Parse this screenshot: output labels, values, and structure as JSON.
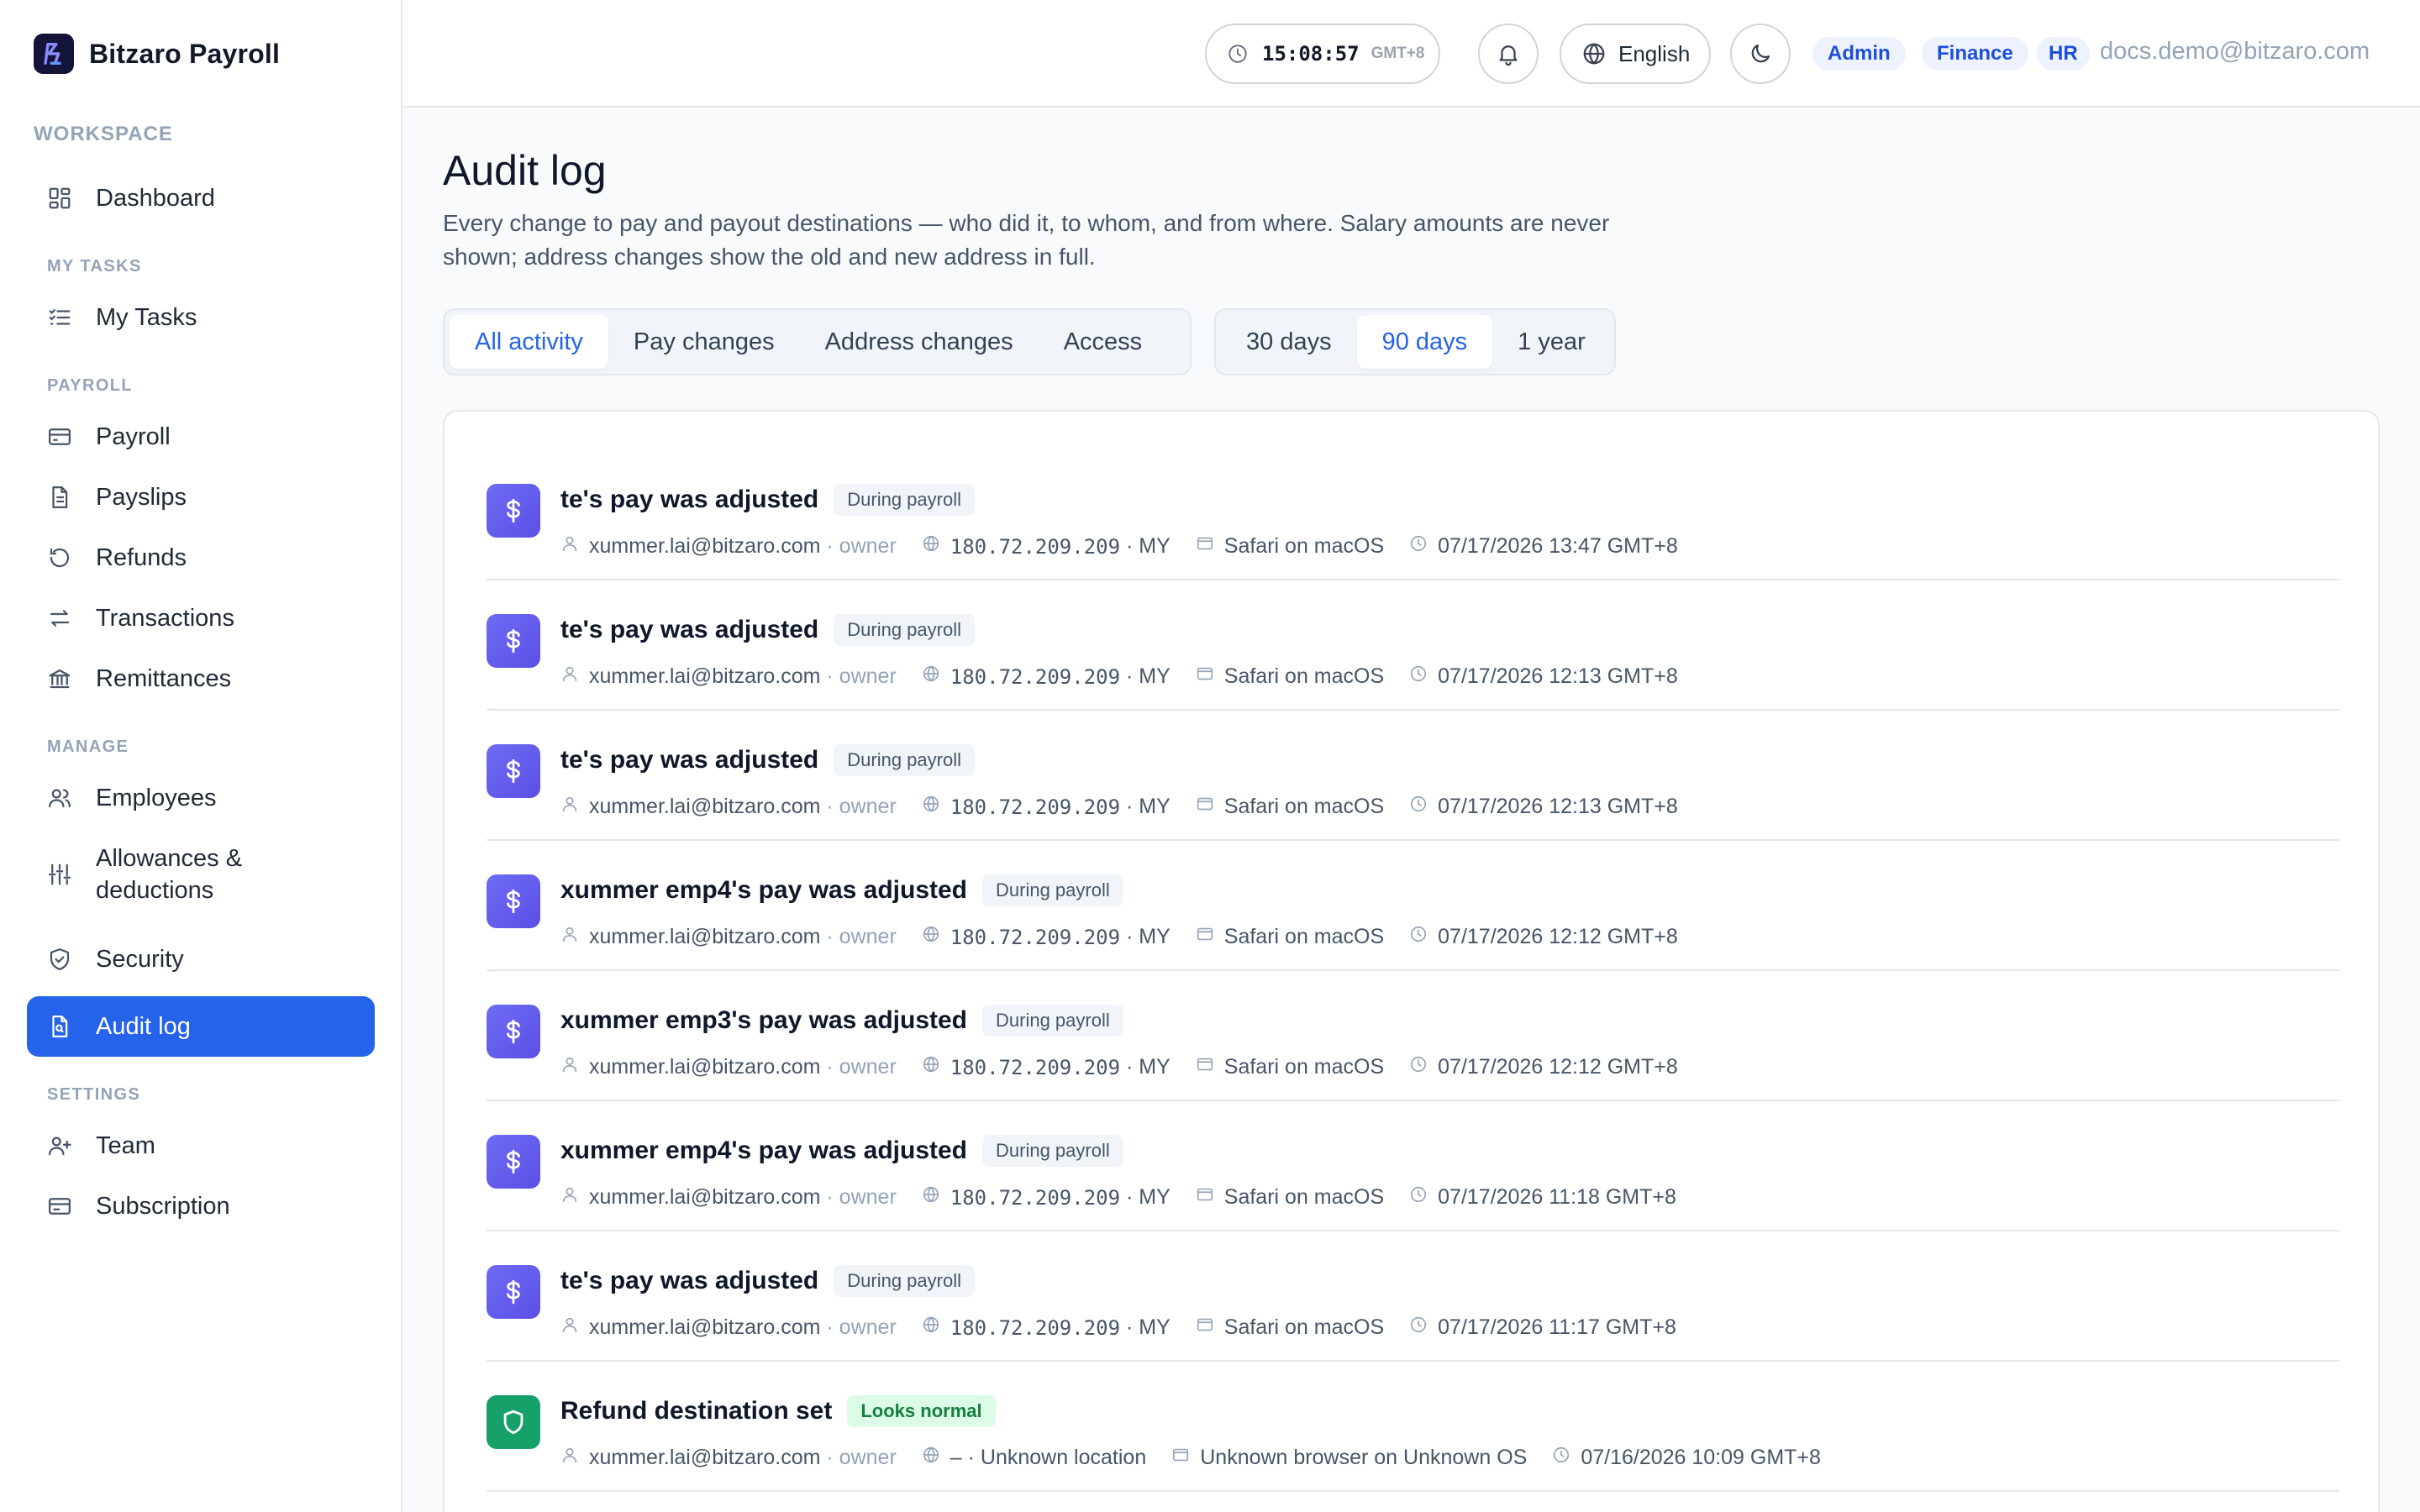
{
  "app": {
    "name": "Bitzaro Payroll"
  },
  "sidebar": {
    "workspace_label": "WORKSPACE",
    "dashboard": "Dashboard",
    "sections": {
      "my_tasks": "MY TASKS",
      "payroll": "PAYROLL",
      "manage": "MANAGE",
      "settings": "SETTINGS"
    },
    "items": {
      "my_tasks": "My Tasks",
      "payroll": "Payroll",
      "payslips": "Payslips",
      "refunds": "Refunds",
      "transactions": "Transactions",
      "remittances": "Remittances",
      "employees": "Employees",
      "allowances_1": "Allowances &",
      "allowances_2": "deductions",
      "security": "Security",
      "audit_log": "Audit log",
      "team": "Team",
      "subscription": "Subscription"
    },
    "active_item": "Audit log"
  },
  "header": {
    "clock_time": "15:08:57",
    "clock_tz": "GMT+8",
    "language": "English",
    "roles": [
      "Admin",
      "Finance",
      "HR"
    ],
    "user_email": "docs.demo@bitzaro.com"
  },
  "page": {
    "title": "Audit log",
    "description": "Every change to pay and payout destinations — who did it, to whom, and from where. Salary amounts are never shown; address changes show the old and new address in full."
  },
  "filters": {
    "types": [
      "All activity",
      "Pay changes",
      "Address changes",
      "Access"
    ],
    "active_type": "All activity",
    "ranges": [
      "30 days",
      "90 days",
      "1 year"
    ],
    "active_range": "90 days"
  },
  "entries": [
    {
      "title": "te's pay was adjusted",
      "tag": "During payroll",
      "kind": "pay",
      "actor": "xummer.lai@bitzaro.com",
      "role": "owner",
      "ip": "180.72.209.209",
      "country": "MY",
      "device": "Safari on macOS",
      "time": "07/17/2026 13:47 GMT+8"
    },
    {
      "title": "te's pay was adjusted",
      "tag": "During payroll",
      "kind": "pay",
      "actor": "xummer.lai@bitzaro.com",
      "role": "owner",
      "ip": "180.72.209.209",
      "country": "MY",
      "device": "Safari on macOS",
      "time": "07/17/2026 12:13 GMT+8"
    },
    {
      "title": "te's pay was adjusted",
      "tag": "During payroll",
      "kind": "pay",
      "actor": "xummer.lai@bitzaro.com",
      "role": "owner",
      "ip": "180.72.209.209",
      "country": "MY",
      "device": "Safari on macOS",
      "time": "07/17/2026 12:13 GMT+8"
    },
    {
      "title": "xummer emp4's pay was adjusted",
      "tag": "During payroll",
      "kind": "pay",
      "actor": "xummer.lai@bitzaro.com",
      "role": "owner",
      "ip": "180.72.209.209",
      "country": "MY",
      "device": "Safari on macOS",
      "time": "07/17/2026 12:12 GMT+8"
    },
    {
      "title": "xummer emp3's pay was adjusted",
      "tag": "During payroll",
      "kind": "pay",
      "actor": "xummer.lai@bitzaro.com",
      "role": "owner",
      "ip": "180.72.209.209",
      "country": "MY",
      "device": "Safari on macOS",
      "time": "07/17/2026 12:12 GMT+8"
    },
    {
      "title": "xummer emp4's pay was adjusted",
      "tag": "During payroll",
      "kind": "pay",
      "actor": "xummer.lai@bitzaro.com",
      "role": "owner",
      "ip": "180.72.209.209",
      "country": "MY",
      "device": "Safari on macOS",
      "time": "07/17/2026 11:18 GMT+8"
    },
    {
      "title": "te's pay was adjusted",
      "tag": "During payroll",
      "kind": "pay",
      "actor": "xummer.lai@bitzaro.com",
      "role": "owner",
      "ip": "180.72.209.209",
      "country": "MY",
      "device": "Safari on macOS",
      "time": "07/17/2026 11:17 GMT+8"
    },
    {
      "title": "Refund destination set",
      "tag": "Looks normal",
      "kind": "shield",
      "actor": "xummer.lai@bitzaro.com",
      "role": "owner",
      "ip": "–",
      "country": "Unknown location",
      "device": "Unknown browser on Unknown OS",
      "time": "07/16/2026 10:09 GMT+8"
    }
  ],
  "icons": {
    "brand": "bitzaro-logo-icon",
    "pay": "dollar-icon",
    "refund": "shield-icon"
  },
  "colors": {
    "accent": "#2563eb",
    "pay_icon": "#5b4fe6",
    "normal_icon": "#16a06a"
  }
}
